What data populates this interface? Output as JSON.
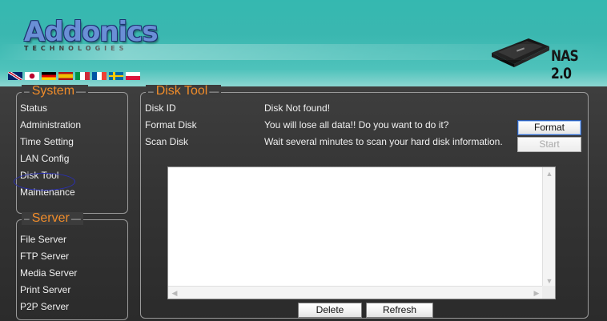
{
  "header": {
    "logo_main": "Addonics",
    "logo_sub": "TECHNOLOGIES",
    "product_title": "NAS 2.0",
    "flags": [
      "uk-flag-icon",
      "japan-flag-icon",
      "germany-flag-icon",
      "spain-flag-icon",
      "italy-flag-icon",
      "france-flag-icon",
      "sweden-flag-icon",
      "poland-flag-icon"
    ]
  },
  "system": {
    "legend": "System",
    "items": [
      "Status",
      "Administration",
      "Time Setting",
      "LAN Config",
      "Disk Tool",
      "Maintenance"
    ]
  },
  "server": {
    "legend": "Server",
    "items": [
      "File Server",
      "FTP Server",
      "Media Server",
      "Print Server",
      "P2P Server"
    ]
  },
  "disktool": {
    "legend": "Disk Tool",
    "rows": [
      {
        "label": "Disk ID",
        "value": "Disk Not found!"
      },
      {
        "label": "Format Disk",
        "value": "You will lose all data!! Do you want to do it?"
      },
      {
        "label": "Scan Disk",
        "value": "Wait several minutes to scan your hard disk information."
      }
    ],
    "format_button": "Format",
    "start_button": "Start",
    "log_text": "",
    "delete_button": "Delete",
    "refresh_button": "Refresh"
  },
  "colors": {
    "header_teal": "#3ab7b0",
    "legend_orange": "#f08c2a",
    "background_dark": "#333333",
    "selection_oval": "#2a2fb5"
  }
}
